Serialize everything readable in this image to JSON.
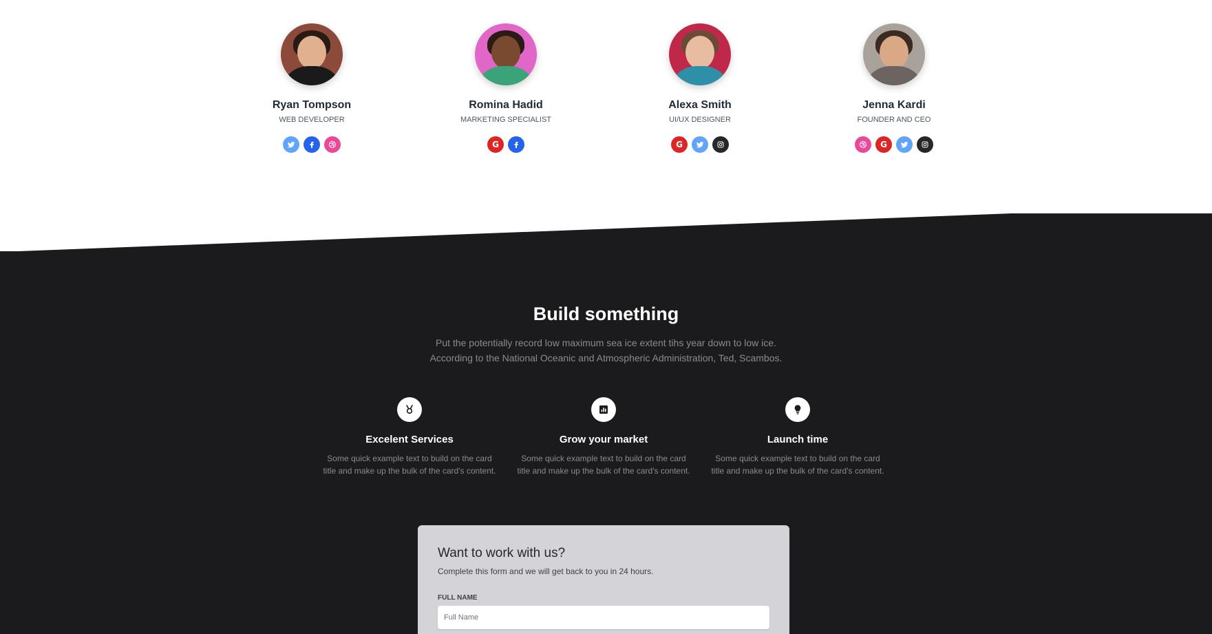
{
  "team": {
    "members": [
      {
        "name": "Ryan Tompson",
        "role": "WEB DEVELOPER",
        "socials": [
          "twitter",
          "facebook",
          "dribbble"
        ]
      },
      {
        "name": "Romina Hadid",
        "role": "MARKETING SPECIALIST",
        "socials": [
          "google",
          "facebook"
        ]
      },
      {
        "name": "Alexa Smith",
        "role": "UI/UX DESIGNER",
        "socials": [
          "google",
          "twitter",
          "instagram"
        ]
      },
      {
        "name": "Jenna Kardi",
        "role": "FOUNDER AND CEO",
        "socials": [
          "dribbble",
          "google",
          "twitter",
          "instagram"
        ]
      }
    ]
  },
  "social_colors": {
    "twitter": "#60a5fa",
    "facebook": "#2563eb",
    "dribbble": "#ec4899",
    "google": "#dc2626",
    "instagram": "#27272a"
  },
  "build": {
    "title": "Build something",
    "desc_line1": "Put the potentially record low maximum sea ice extent tihs year down to low ice.",
    "desc_line2": "According to the National Oceanic and Atmospheric Administration, Ted, Scambos."
  },
  "features": [
    {
      "icon": "medal-icon",
      "title": "Excelent Services",
      "line1": "Some quick example text to build on the card",
      "line2": "title and make up the bulk of the card's content."
    },
    {
      "icon": "chart-icon",
      "title": "Grow your market",
      "line1": "Some quick example text to build on the card",
      "line2": "title and make up the bulk of the card's content."
    },
    {
      "icon": "lightbulb-icon",
      "title": "Launch time",
      "line1": "Some quick example text to build on the card",
      "line2": "title and make up the bulk of the card's content."
    }
  ],
  "form": {
    "title": "Want to work with us?",
    "subtitle": "Complete this form and we will get back to you in 24 hours.",
    "full_name_label": "FULL NAME",
    "full_name_placeholder": "Full Name"
  },
  "colors": {
    "dark_bg": "#1b1b1d",
    "card_bg": "#d4d4d8"
  }
}
